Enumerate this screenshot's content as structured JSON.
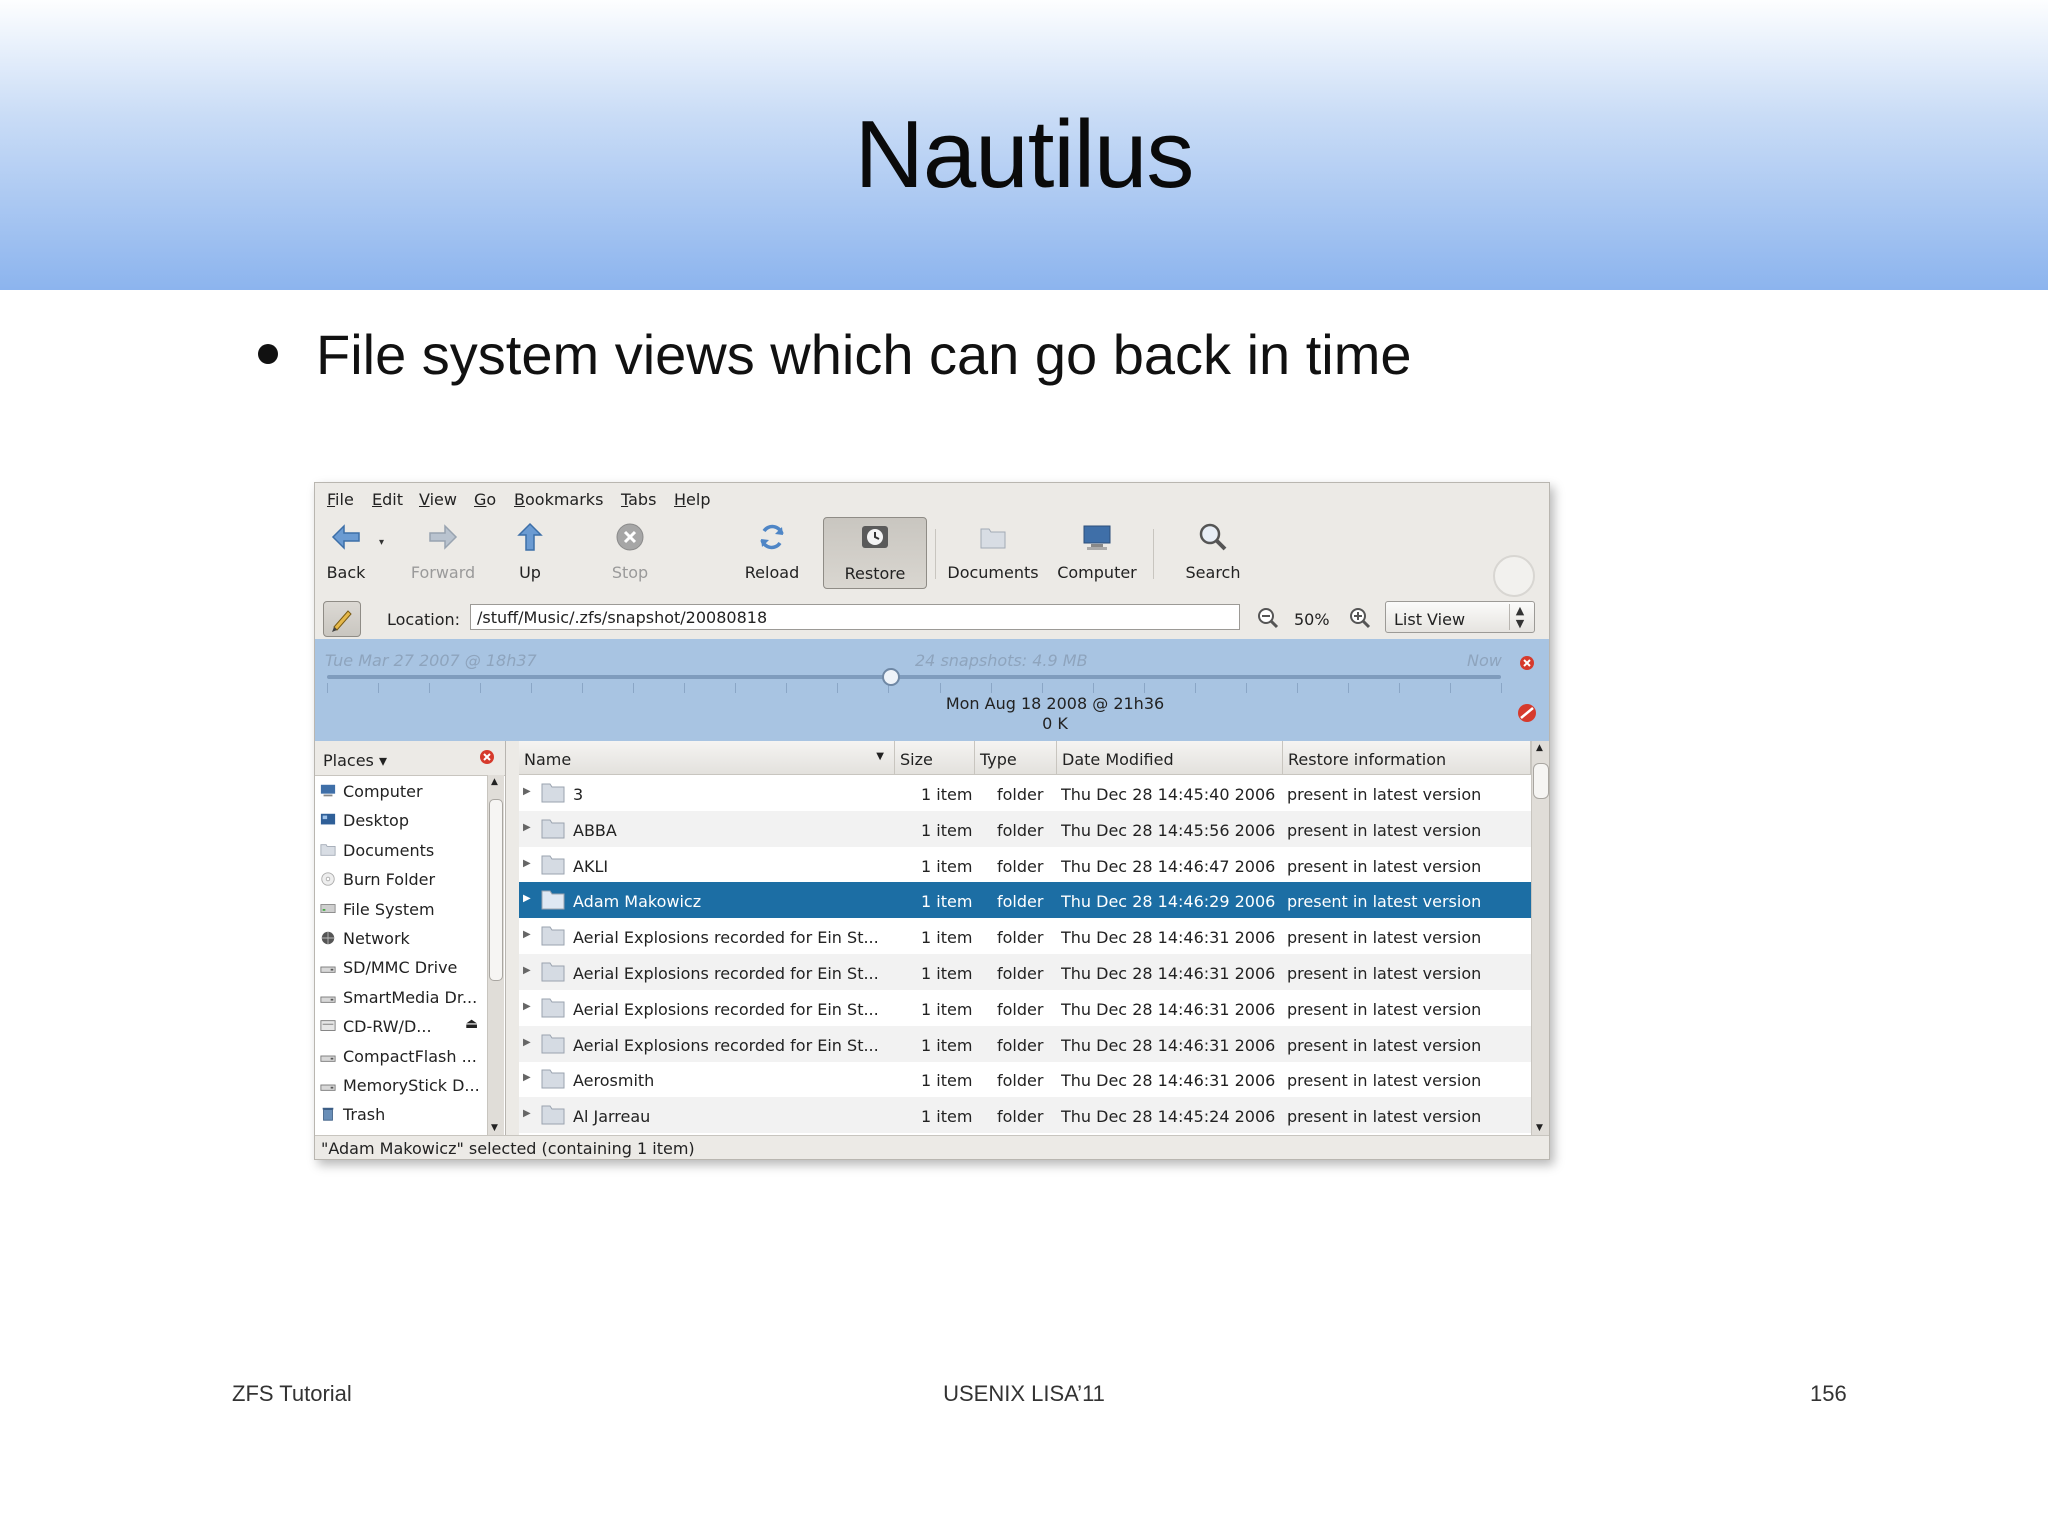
{
  "slide": {
    "title": "Nautilus",
    "bullet": "File system views which can go back in time",
    "footer_left": "ZFS Tutorial",
    "footer_center": "USENIX LISA’11",
    "footer_right": "156"
  },
  "window": {
    "menu": [
      {
        "key": "F",
        "rest": "ile"
      },
      {
        "key": "E",
        "rest": "dit"
      },
      {
        "key": "V",
        "rest": "iew"
      },
      {
        "key": "G",
        "rest": "o"
      },
      {
        "key": "B",
        "rest": "ookmarks"
      },
      {
        "key": "T",
        "rest": "abs"
      },
      {
        "key": "H",
        "rest": "elp"
      }
    ],
    "toolbar": {
      "back": "Back",
      "forward": "Forward",
      "up": "Up",
      "stop": "Stop",
      "reload": "Reload",
      "restore": "Restore",
      "documents": "Documents",
      "computer": "Computer",
      "search": "Search"
    },
    "location": {
      "label": "Location:",
      "value": "/stuff/Music/.zfs/snapshot/20080818",
      "zoom": "50%",
      "view": "List View"
    },
    "timeline": {
      "start": "Tue Mar 27 2007 @ 18h37",
      "summary": "24 snapshots: 4.9 MB",
      "end": "Now",
      "selected_date": "Mon Aug 18 2008 @ 21h36",
      "selected_size": "0 K",
      "position": 0.48
    },
    "places": {
      "header": "Places",
      "items": [
        {
          "label": "Computer",
          "icon": "computer-icon"
        },
        {
          "label": "Desktop",
          "icon": "desktop-icon"
        },
        {
          "label": "Documents",
          "icon": "folder-icon"
        },
        {
          "label": "Burn Folder",
          "icon": "disc-icon"
        },
        {
          "label": "File System",
          "icon": "harddisk-icon"
        },
        {
          "label": "Network",
          "icon": "network-icon"
        },
        {
          "label": "SD/MMC Drive",
          "icon": "drive-icon"
        },
        {
          "label": "SmartMedia Dr...",
          "icon": "drive-icon"
        },
        {
          "label": "CD-RW/D...",
          "icon": "optical-drive-icon"
        },
        {
          "label": "CompactFlash ...",
          "icon": "drive-icon"
        },
        {
          "label": "MemoryStick D...",
          "icon": "drive-icon"
        },
        {
          "label": "Trash",
          "icon": "trash-icon"
        }
      ]
    },
    "columns": {
      "name": "Name",
      "size": "Size",
      "type": "Type",
      "date": "Date Modified",
      "restore": "Restore information"
    },
    "files": [
      {
        "name": "3",
        "size": "1 item",
        "type": "folder",
        "date": "Thu Dec 28 14:45:40 2006",
        "restore": "present in latest version"
      },
      {
        "name": "ABBA",
        "size": "1 item",
        "type": "folder",
        "date": "Thu Dec 28 14:45:56 2006",
        "restore": "present in latest version"
      },
      {
        "name": "AKLI",
        "size": "1 item",
        "type": "folder",
        "date": "Thu Dec 28 14:46:47 2006",
        "restore": "present in latest version"
      },
      {
        "name": "Adam Makowicz",
        "size": "1 item",
        "type": "folder",
        "date": "Thu Dec 28 14:46:29 2006",
        "restore": "present in latest version"
      },
      {
        "name": "Aerial Explosions recorded for Ein St...",
        "size": "1 item",
        "type": "folder",
        "date": "Thu Dec 28 14:46:31 2006",
        "restore": "present in latest version"
      },
      {
        "name": "Aerial Explosions recorded for Ein St...",
        "size": "1 item",
        "type": "folder",
        "date": "Thu Dec 28 14:46:31 2006",
        "restore": "present in latest version"
      },
      {
        "name": "Aerial Explosions recorded for Ein St...",
        "size": "1 item",
        "type": "folder",
        "date": "Thu Dec 28 14:46:31 2006",
        "restore": "present in latest version"
      },
      {
        "name": "Aerial Explosions recorded for Ein St...",
        "size": "1 item",
        "type": "folder",
        "date": "Thu Dec 28 14:46:31 2006",
        "restore": "present in latest version"
      },
      {
        "name": "Aerosmith",
        "size": "1 item",
        "type": "folder",
        "date": "Thu Dec 28 14:46:31 2006",
        "restore": "present in latest version"
      },
      {
        "name": "Al Jarreau",
        "size": "1 item",
        "type": "folder",
        "date": "Thu Dec 28 14:45:24 2006",
        "restore": "present in latest version"
      }
    ],
    "selected_row": 3,
    "status": "\"Adam Makowicz\" selected (containing 1 item)",
    "colors": {
      "selection": "#1c6ea4",
      "timeline_bg": "#a8c4e2",
      "header_gradient_bottom": "#8cb4ee"
    }
  }
}
